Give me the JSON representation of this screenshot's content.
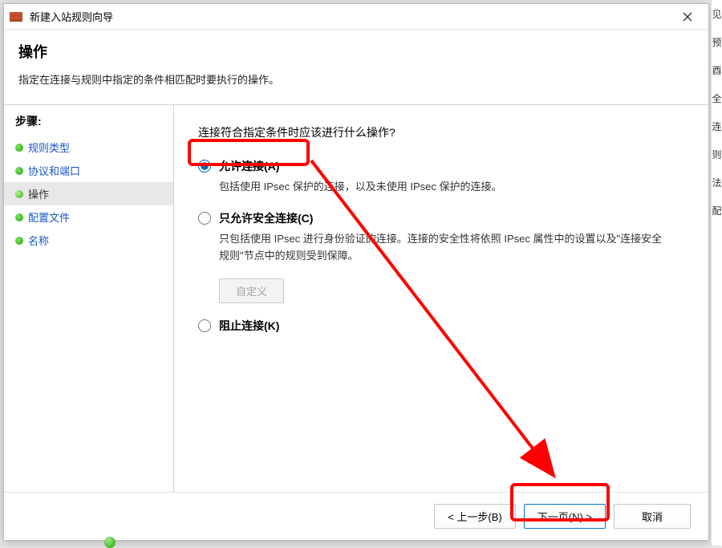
{
  "titlebar": {
    "icon_name": "firewall-icon",
    "title": "新建入站规则向导"
  },
  "header": {
    "title": "操作",
    "subtitle": "指定在连接与规则中指定的条件相匹配时要执行的操作。"
  },
  "sidebar": {
    "heading": "步骤:",
    "items": [
      {
        "label": "规则类型",
        "active": false,
        "link": true
      },
      {
        "label": "协议和端口",
        "active": false,
        "link": true
      },
      {
        "label": "操作",
        "active": true,
        "link": false
      },
      {
        "label": "配置文件",
        "active": false,
        "link": true
      },
      {
        "label": "名称",
        "active": false,
        "link": true
      }
    ]
  },
  "content": {
    "prompt": "连接符合指定条件时应该进行什么操作?",
    "options": [
      {
        "id": "allow",
        "label": "允许连接(A)",
        "desc": "包括使用 IPsec 保护的连接，以及未使用 IPsec 保护的连接。",
        "selected": true
      },
      {
        "id": "allow-secure",
        "label": "只允许安全连接(C)",
        "desc": "只包括使用 IPsec 进行身份验证的连接。连接的安全性将依照 IPsec 属性中的设置以及\"连接安全规则\"节点中的规则受到保障。",
        "selected": false
      },
      {
        "id": "block",
        "label": "阻止连接(K)",
        "desc": "",
        "selected": false
      }
    ],
    "customize_button": "自定义"
  },
  "footer": {
    "back": "< 上一步(B)",
    "next": "下一页(N) >",
    "cancel": "取消"
  },
  "right_edge_chars": [
    "见",
    "预",
    "酉",
    "全",
    "连",
    "则",
    "法",
    "配"
  ]
}
